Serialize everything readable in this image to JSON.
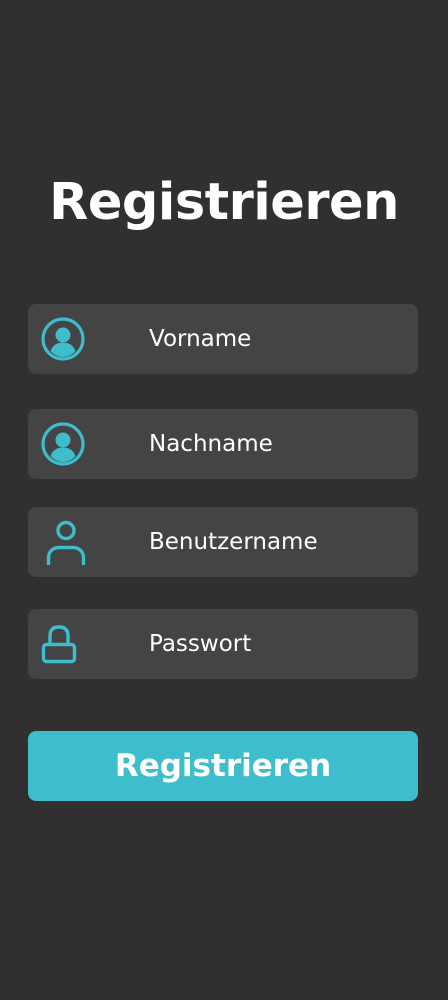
{
  "page": {
    "title": "Registrieren"
  },
  "form": {
    "fields": [
      {
        "placeholder": "Vorname",
        "icon": "account-circle-icon"
      },
      {
        "placeholder": "Nachname",
        "icon": "account-circle-icon"
      },
      {
        "placeholder": "Benutzername",
        "icon": "user-outline-icon"
      },
      {
        "placeholder": "Passwort",
        "icon": "lock-icon"
      }
    ],
    "submit_label": "Registrieren"
  },
  "colors": {
    "background": "#312f30",
    "field_background": "#444444",
    "accent": "#3ebdcd",
    "text": "#ffffff"
  }
}
